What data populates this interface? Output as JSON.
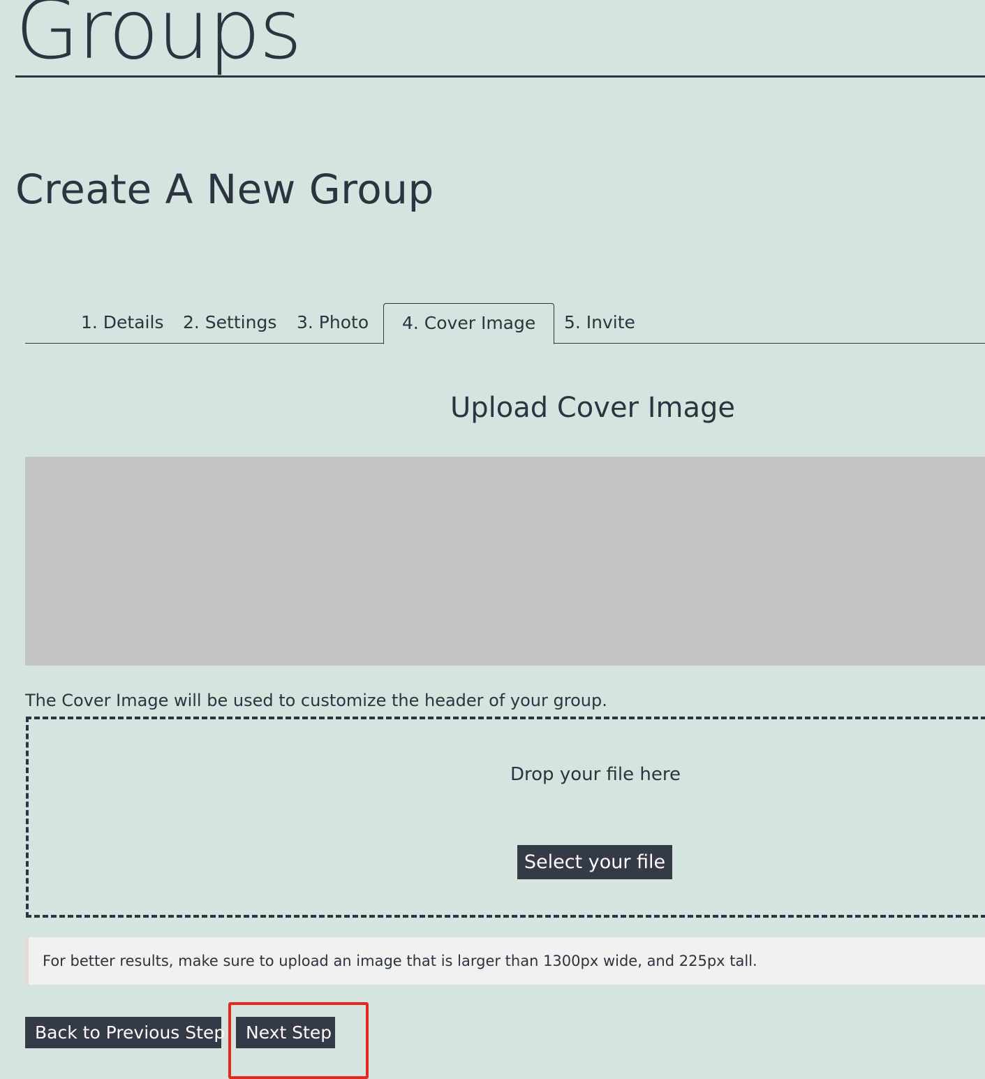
{
  "site": {
    "title": "Groups"
  },
  "page": {
    "title": "Create A New Group"
  },
  "tabs": [
    {
      "label": "1. Details",
      "active": false
    },
    {
      "label": "2. Settings",
      "active": false
    },
    {
      "label": "3. Photo",
      "active": false
    },
    {
      "label": "4. Cover Image",
      "active": true
    },
    {
      "label": "5. Invite",
      "active": false
    }
  ],
  "upload": {
    "heading": "Upload Cover Image",
    "help_text": "The Cover Image will be used to customize the header of your group.",
    "drop_text": "Drop your file here",
    "select_label": "Select your file",
    "notice": "For better results, make sure to upload an image that is larger than 1300px wide, and 225px tall."
  },
  "actions": {
    "back_label": "Back to Previous Step",
    "next_label": "Next Step"
  },
  "colors": {
    "background": "#d5e4de",
    "text": "#2b3440",
    "button": "#343b46",
    "preview": "#c4c4c4",
    "highlight": "#e5271c"
  }
}
